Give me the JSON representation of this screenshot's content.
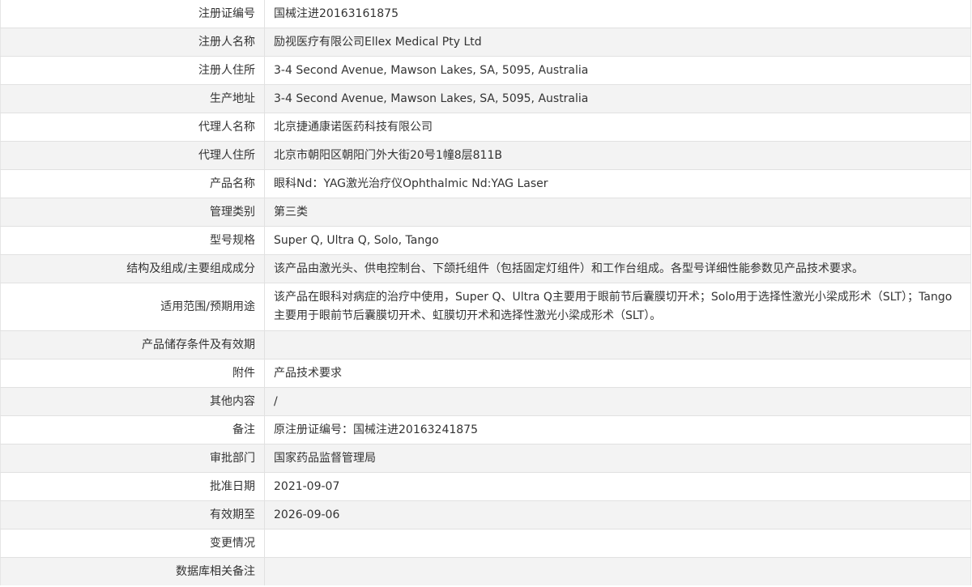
{
  "rows": [
    {
      "label": "注册证编号",
      "value": "国械注进20163161875"
    },
    {
      "label": "注册人名称",
      "value": "励视医疗有限公司Ellex Medical Pty Ltd"
    },
    {
      "label": "注册人住所",
      "value": "3-4 Second Avenue, Mawson Lakes, SA, 5095, Australia"
    },
    {
      "label": "生产地址",
      "value": "3-4 Second Avenue, Mawson Lakes, SA, 5095, Australia"
    },
    {
      "label": "代理人名称",
      "value": "北京捷通康诺医药科技有限公司"
    },
    {
      "label": "代理人住所",
      "value": "北京市朝阳区朝阳门外大街20号1幢8层811B"
    },
    {
      "label": "产品名称",
      "value": "眼科Nd：YAG激光治疗仪Ophthalmic Nd:YAG Laser"
    },
    {
      "label": "管理类别",
      "value": "第三类"
    },
    {
      "label": "型号规格",
      "value": "Super Q, Ultra Q, Solo, Tango"
    },
    {
      "label": "结构及组成/主要组成成分",
      "value": "该产品由激光头、供电控制台、下颌托组件（包括固定灯组件）和工作台组成。各型号详细性能参数见产品技术要求。"
    },
    {
      "label": "适用范围/预期用途",
      "value": "该产品在眼科对病症的治疗中使用，Super Q、Ultra Q主要用于眼前节后囊膜切开术；Solo用于选择性激光小梁成形术（SLT）；Tango主要用于眼前节后囊膜切开术、虹膜切开术和选择性激光小梁成形术（SLT）。"
    },
    {
      "label": "产品储存条件及有效期",
      "value": ""
    },
    {
      "label": "附件",
      "value": "产品技术要求"
    },
    {
      "label": "其他内容",
      "value": "/"
    },
    {
      "label": "备注",
      "value": "原注册证编号：国械注进20163241875"
    },
    {
      "label": "审批部门",
      "value": "国家药品监督管理局"
    },
    {
      "label": "批准日期",
      "value": "2021-09-07"
    },
    {
      "label": "有效期至",
      "value": "2026-09-06"
    },
    {
      "label": "变更情况",
      "value": ""
    },
    {
      "label": "数据库相关备注",
      "value": ""
    }
  ]
}
